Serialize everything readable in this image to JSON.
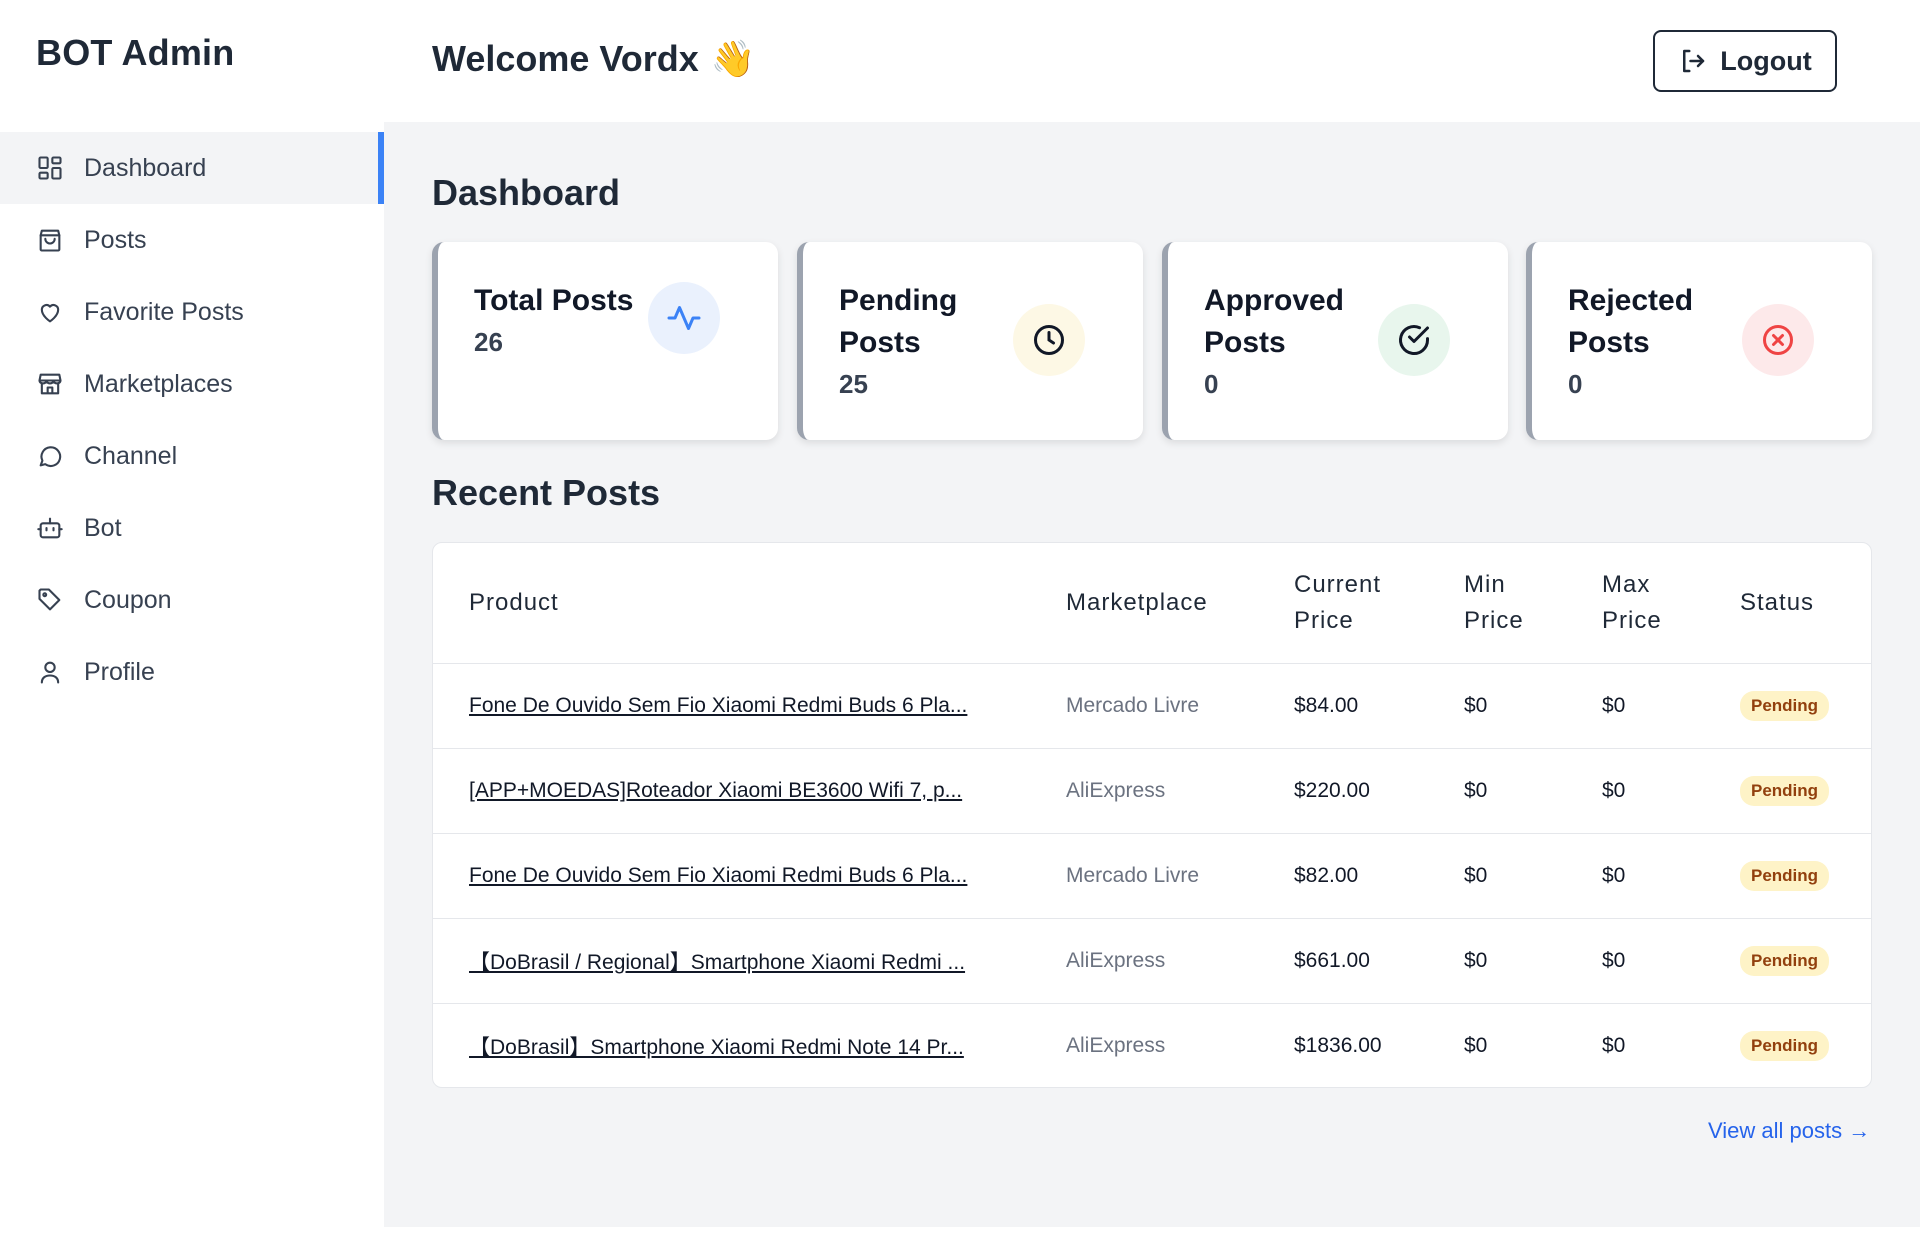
{
  "sidebar": {
    "brand": "BOT Admin",
    "items": [
      {
        "label": "Dashboard",
        "icon": "dashboard-icon"
      },
      {
        "label": "Posts",
        "icon": "shopping-bag-icon"
      },
      {
        "label": "Favorite Posts",
        "icon": "heart-icon"
      },
      {
        "label": "Marketplaces",
        "icon": "store-icon"
      },
      {
        "label": "Channel",
        "icon": "message-circle-icon"
      },
      {
        "label": "Bot",
        "icon": "bot-icon"
      },
      {
        "label": "Coupon",
        "icon": "tag-icon"
      },
      {
        "label": "Profile",
        "icon": "user-icon"
      }
    ]
  },
  "header": {
    "welcome": "Welcome Vordx",
    "wave_emoji": "👋",
    "logout_label": "Logout"
  },
  "main": {
    "title": "Dashboard",
    "cards": [
      {
        "title": "Total Posts",
        "value": "26",
        "icon": "activity-icon",
        "icon_color": "#3b82f6",
        "icon_bg": "#eaf1fd"
      },
      {
        "title": "Pending Posts",
        "value": "25",
        "icon": "clock-icon",
        "icon_color": "#111827",
        "icon_bg": "#fdf8e5"
      },
      {
        "title": "Approved Posts",
        "value": "0",
        "icon": "check-circle-icon",
        "icon_color": "#111827",
        "icon_bg": "#e8f6ed"
      },
      {
        "title": "Rejected Posts",
        "value": "0",
        "icon": "x-circle-icon",
        "icon_color": "#ef4444",
        "icon_bg": "#fde9ea"
      }
    ],
    "recent_title": "Recent Posts",
    "table": {
      "headers": [
        "Product",
        "Marketplace",
        "Current Price",
        "Min Price",
        "Max Price",
        "Status"
      ],
      "rows": [
        {
          "product": "Fone De Ouvido Sem Fio Xiaomi Redmi Buds 6 Pla...",
          "marketplace": "Mercado Livre",
          "current": "$84.00",
          "min": "$0",
          "max": "$0",
          "status": "Pending"
        },
        {
          "product": "[APP+MOEDAS]Roteador Xiaomi BE3600 Wifi 7, p...",
          "marketplace": "AliExpress",
          "current": "$220.00",
          "min": "$0",
          "max": "$0",
          "status": "Pending"
        },
        {
          "product": "Fone De Ouvido Sem Fio Xiaomi Redmi Buds 6 Pla...",
          "marketplace": "Mercado Livre",
          "current": "$82.00",
          "min": "$0",
          "max": "$0",
          "status": "Pending"
        },
        {
          "product": "【DoBrasil / Regional】Smartphone Xiaomi Redmi ...",
          "marketplace": "AliExpress",
          "current": "$661.00",
          "min": "$0",
          "max": "$0",
          "status": "Pending"
        },
        {
          "product": "【DoBrasil】Smartphone Xiaomi Redmi Note 14 Pr...",
          "marketplace": "AliExpress",
          "current": "$1836.00",
          "min": "$0",
          "max": "$0",
          "status": "Pending"
        }
      ]
    },
    "view_all": "View all posts →"
  },
  "colors": {
    "accent": "#3b82f6",
    "link": "#2563eb",
    "pending_bg": "#fef3c7",
    "pending_text": "#92400e"
  }
}
